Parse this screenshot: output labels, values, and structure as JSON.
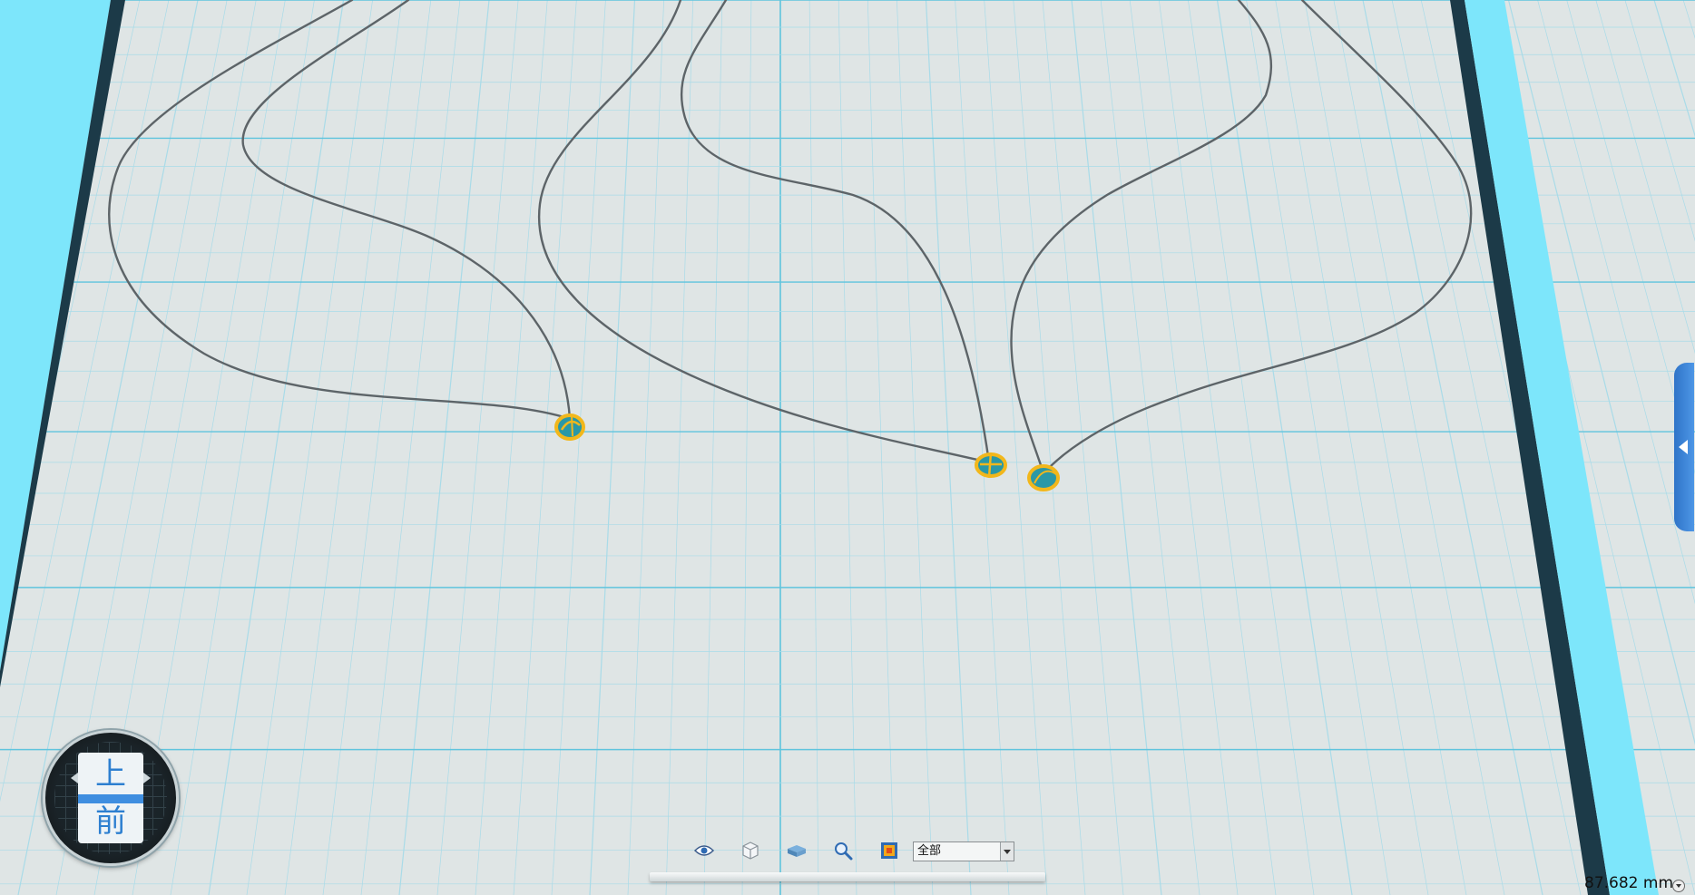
{
  "viewcube": {
    "top_label": "上",
    "front_label": "前"
  },
  "toolbar": {
    "buttons": [
      {
        "name": "visibility-eye-icon"
      },
      {
        "name": "wireframe-cube-icon"
      },
      {
        "name": "shaded-plate-icon"
      },
      {
        "name": "zoom-magnifier-icon"
      },
      {
        "name": "render-frame-icon"
      }
    ],
    "filter_value": "全部"
  },
  "status": {
    "distance": "87.682 mm"
  },
  "colors": {
    "background": "#dfe5e5",
    "grid_line": "#a9dbe8",
    "grid_axis": "#5fc4dd",
    "rail_cyan": "#7de6fb",
    "rail_dark": "#1c3a48",
    "curve": "#5d6468",
    "node_fill": "#2a98a6",
    "node_ring": "#f2b71b",
    "accent_blue": "#3f8ee0"
  }
}
